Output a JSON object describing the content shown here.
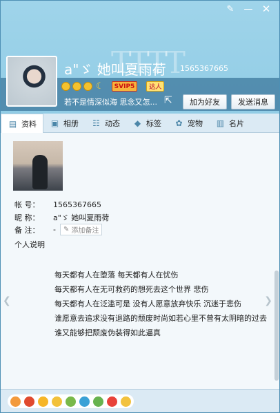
{
  "window": {
    "controls": {
      "skin": "✎",
      "minimize": "—",
      "close": "✕"
    }
  },
  "profile": {
    "nickname": "a\"ゞ 她叫夏雨荷",
    "id": "1565367665",
    "badges": {
      "svip": "SVIP5",
      "daren": "达人"
    },
    "signature": "若不是情深似海  思念又怎..."
  },
  "actions": {
    "add_friend": "加为好友",
    "send_message": "发送消息"
  },
  "tabs": [
    {
      "label": "资料",
      "icon": "profile-card-icon"
    },
    {
      "label": "相册",
      "icon": "photo-album-icon"
    },
    {
      "label": "动态",
      "icon": "feed-icon"
    },
    {
      "label": "标签",
      "icon": "tag-icon"
    },
    {
      "label": "宠物",
      "icon": "pet-icon"
    },
    {
      "label": "名片",
      "icon": "business-card-icon"
    }
  ],
  "info": {
    "account_label": "帐    号：",
    "account_value": "1565367665",
    "nickname_label": "昵    称：",
    "nickname_value": "a\"ゞ 她叫夏雨荷",
    "remark_label": "备    注：",
    "remark_value": "-",
    "remark_placeholder": "添加备注",
    "bio_label": "个人说明"
  },
  "bio_lines": [
    "每天都有人在堕落 每天都有人在忧伤",
    "每天都有人在无可救药的想死去这个世界 悲伤",
    "每天都有人在泛滥可是 没有人愿意放弃快乐 沉迷于悲伤",
    "谁愿意去追求没有退路的颓废时尚如若心里不曾有太阴暗的过去",
    "谁又能够把颓废伪装得如此逼真"
  ],
  "colors": {
    "accent": "#4b86a8",
    "header": "#8cc9e3"
  }
}
